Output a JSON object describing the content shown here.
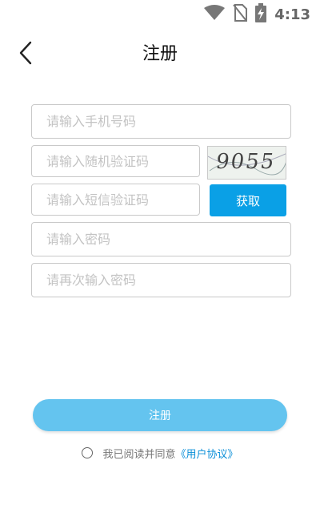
{
  "status_bar": {
    "time": "4:13",
    "icons": [
      "wifi-icon",
      "no-sim-icon",
      "battery-charging-icon"
    ]
  },
  "header": {
    "title": "注册",
    "back_icon": "chevron-left-icon"
  },
  "form": {
    "phone_placeholder": "请输入手机号码",
    "random_code_placeholder": "请输入随机验证码",
    "captcha_text": "9055",
    "sms_code_placeholder": "请输入短信验证码",
    "get_code_label": "获取",
    "password_placeholder": "请输入密码",
    "confirm_password_placeholder": "请再次输入密码"
  },
  "actions": {
    "register_label": "注册"
  },
  "agreement": {
    "text": "我已阅读并同意",
    "link": "《用户协议》"
  },
  "colors": {
    "accent": "#0aa0e6",
    "register_button": "#64c4ef",
    "link": "#0a8fd8"
  }
}
